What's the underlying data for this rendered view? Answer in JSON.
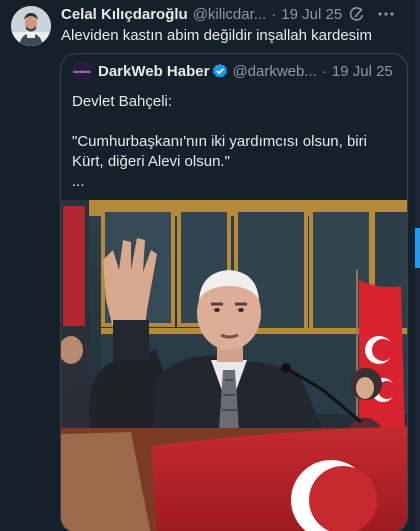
{
  "tweet": {
    "author_name": "Celal Kılıçdaroğlu",
    "author_handle": "@kilicdar...",
    "separator": "·",
    "date": "19 Jul 25",
    "text": "Aleviden kastın abim değildir inşallah kardesim"
  },
  "quoted_tweet": {
    "avatar_text": "DarkWeb",
    "author_name": "DarkWeb Haber",
    "author_handle": "@darkweb...",
    "separator": "·",
    "date": "19 Jul 25",
    "line1": "Devlet Bahçeli:",
    "line2": "\"Cumhurbaşkanı'nın iki yardımcısı olsun, biri Kürt, diğeri Alevi olsun.\"",
    "line3": "..."
  },
  "colors": {
    "background": "#15202b",
    "text": "#e7e9ea",
    "secondary_text": "#8b98a5",
    "verified": "#1d9bf0",
    "flag_red": "#d9232e"
  },
  "icons": [
    "grok-icon",
    "more-icon",
    "verified-badge-icon"
  ]
}
